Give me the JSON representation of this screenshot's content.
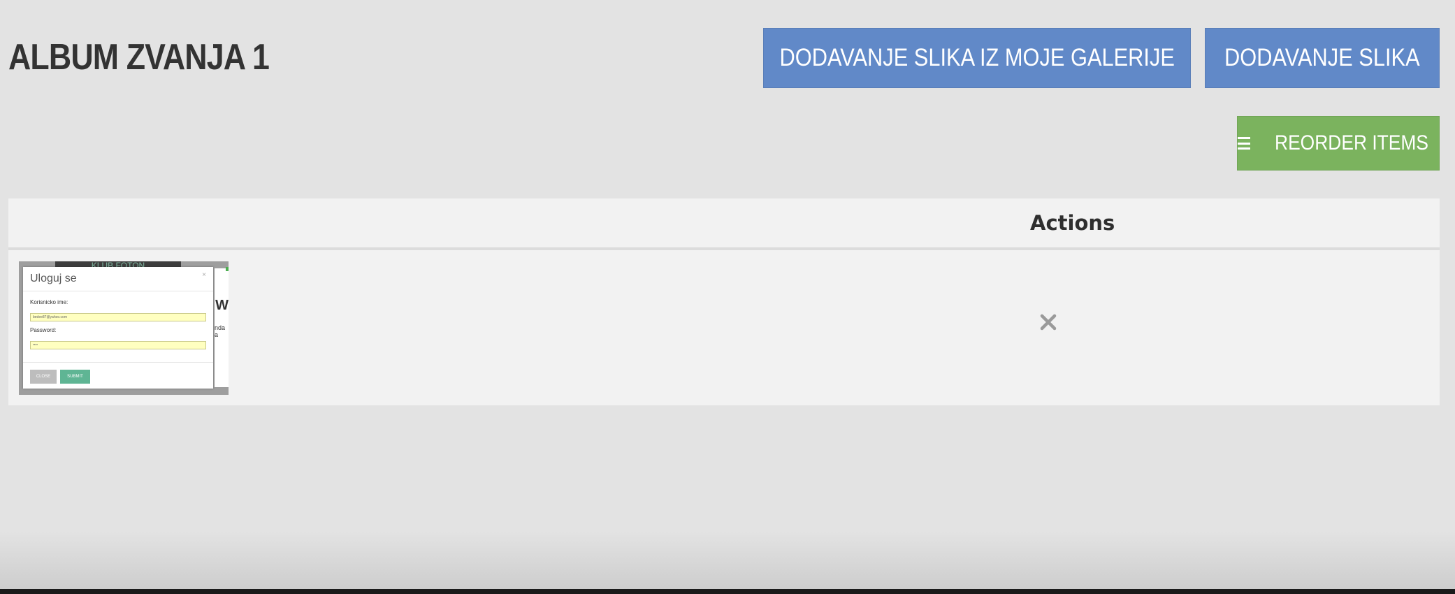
{
  "header": {
    "title": "ALBUM ZVANJA 1"
  },
  "toolbar": {
    "add_from_gallery_label": "DODAVANJE SLIKA IZ MOJE GALERIJE",
    "add_images_label": "DODAVANJE SLIKA",
    "reorder_label": "REORDER ITEMS",
    "reorder_icon": "menu-icon"
  },
  "colors": {
    "background": "#e3e3e3",
    "primary_button": "#6189c8",
    "reorder_button": "#7bb35e",
    "table_background": "#f2f2f2",
    "delete_icon": "#9a9a9a"
  },
  "table": {
    "columns": [
      "",
      "Actions"
    ],
    "rows": [
      {
        "thumbnail": {
          "modal_title": "Uloguj se",
          "username_label": "Korisnicko ime:",
          "username_value": "bedee87@yahoo.com",
          "password_label": "Password:",
          "password_value": "••••",
          "close_button": "CLOSE",
          "submit_button": "SUBMIT",
          "background_header": "KLUB FOTON",
          "background_letter": "W",
          "background_snippet": "nda a"
        },
        "action_icon": "delete-x-icon"
      }
    ]
  }
}
